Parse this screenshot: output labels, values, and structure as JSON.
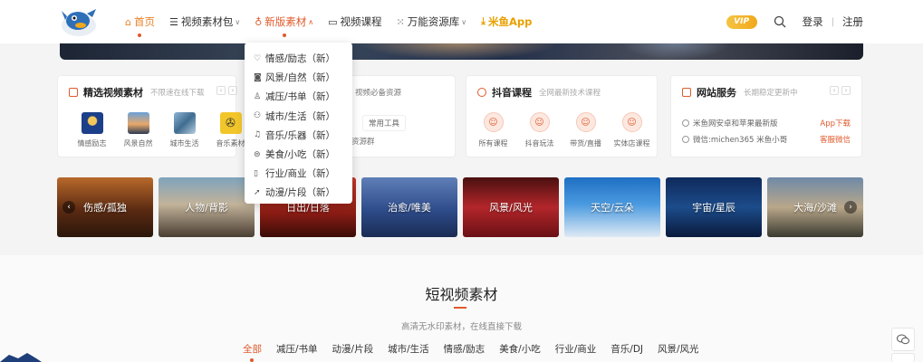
{
  "header": {
    "nav": [
      {
        "label": "首页",
        "icon": "home-icon"
      },
      {
        "label": "视频素材包",
        "icon": "list-icon"
      },
      {
        "label": "新版素材",
        "icon": "sparkle-icon"
      },
      {
        "label": "视频课程",
        "icon": "monitor-icon"
      },
      {
        "label": "万能资源库",
        "icon": "grid-icon"
      },
      {
        "label": "米鱼App",
        "icon": "download-icon"
      }
    ],
    "vip_label": "VIP",
    "login": "登录",
    "sep": "|",
    "register": "注册"
  },
  "dropdown": {
    "items": [
      {
        "label": "情感/励志（新）",
        "icon": "heart-icon"
      },
      {
        "label": "风景/自然（新）",
        "icon": "camera-icon"
      },
      {
        "label": "减压/书单（新）",
        "icon": "person-icon"
      },
      {
        "label": "城市/生活（新）",
        "icon": "people-icon"
      },
      {
        "label": "音乐/乐器（新）",
        "icon": "music-icon"
      },
      {
        "label": "美食/小吃（新）",
        "icon": "food-icon"
      },
      {
        "label": "行业/商业（新）",
        "icon": "document-icon"
      },
      {
        "label": "动漫/片段（新）",
        "icon": "rocket-icon"
      }
    ]
  },
  "cards": {
    "featured": {
      "title": "精选视频素材",
      "subtitle": "不限速在线下载",
      "items": [
        "情感励志",
        "风景自然",
        "城市生活",
        "音乐素材"
      ]
    },
    "resources": {
      "text1": "视频必备资源",
      "tool": "常用工具",
      "text2": "资源群"
    },
    "douyin": {
      "title": "抖音课程",
      "subtitle": "全网最新技术课程",
      "items": [
        "所有课程",
        "抖音玩法",
        "带货/直播",
        "实体店课程"
      ]
    },
    "service": {
      "title": "网站服务",
      "subtitle": "长期稳定更新中",
      "line1": "米鱼网安卓和苹果最新版",
      "tag1": "App下载",
      "line2": "微信:michen365 米鱼小哥",
      "tag2": "客服微信"
    }
  },
  "tiles": [
    "伤感/孤独",
    "人物/背影",
    "日出/日落",
    "治愈/唯美",
    "风景/风光",
    "天空/云朵",
    "宇宙/星辰",
    "大海/沙滩"
  ],
  "section": {
    "title": "短视频素材",
    "subtitle": "高清无水印素材，在线直接下载",
    "categories": [
      "全部",
      "减压/书单",
      "动漫/片段",
      "城市/生活",
      "情感/励志",
      "美食/小吃",
      "行业/商业",
      "音乐/DJ",
      "风景/风光"
    ]
  },
  "colors": {
    "accent": "#e05a2b",
    "vip": "#f0a81c",
    "app": "#e8a000"
  }
}
